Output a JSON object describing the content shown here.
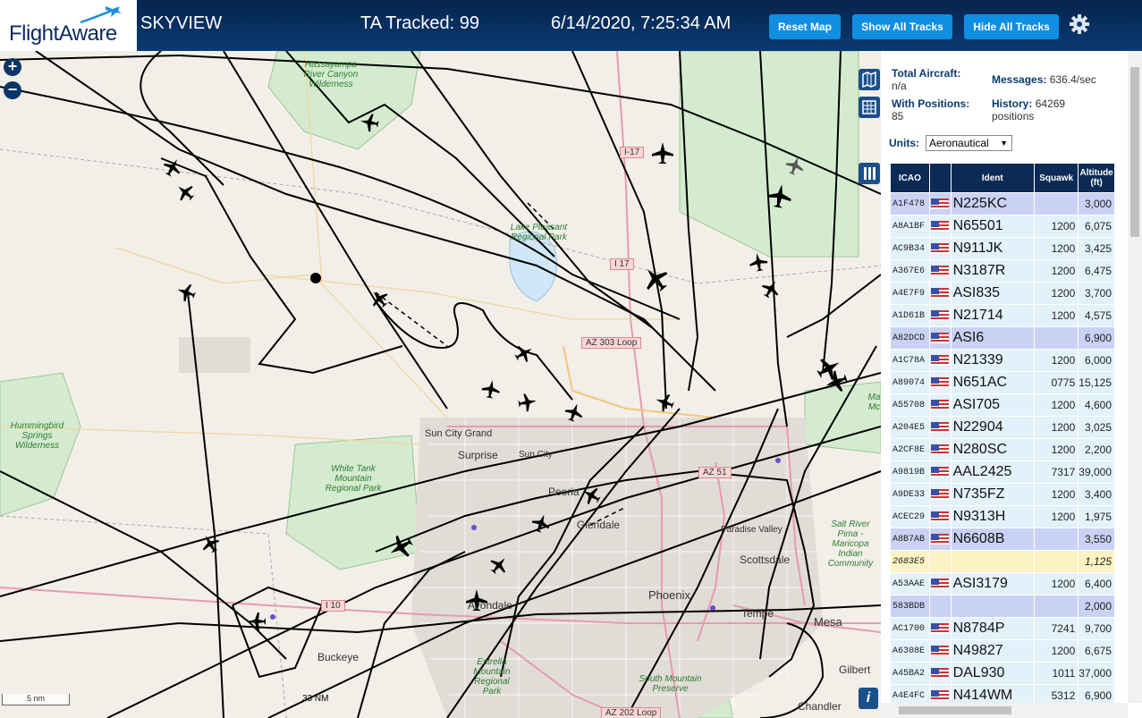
{
  "header": {
    "brand": "FlightAware",
    "site_name": "SKYVIEW",
    "tracked": "TA Tracked: 99",
    "datetime": "6/14/2020, 7:25:34 AM",
    "buttons": {
      "reset": "Reset Map",
      "show_all": "Show All Tracks",
      "hide_all": "Hide All Tracks"
    },
    "icons": {
      "settings": "gear-icon",
      "logo": "plane-icon"
    }
  },
  "map": {
    "zoom_in": "+",
    "zoom_out": "−",
    "controls": [
      "map-layers-icon",
      "grid-icon",
      "columns-icon"
    ],
    "info": "i",
    "scale_label": "5 nm",
    "range_label": "33 NM",
    "places": [
      "Sun City Grand",
      "Surprise",
      "Sun City",
      "Peoria",
      "Glendale",
      "Paradise Valley",
      "Scottsdale",
      "Phoenix",
      "Tempe",
      "Mesa",
      "Avondale",
      "Buckeye",
      "Gilbert",
      "Chandler"
    ],
    "parks": [
      "Hassayampa River Canyon Wilderness",
      "Lake Pleasant Regional Park",
      "Hummingbird Springs Wilderness",
      "White Tank Mountain Regional Park",
      "Estrella Mountain Regional Park",
      "South Mountain Preserve",
      "Salt River Pima - Maricopa Indian Community",
      "Ma Mc"
    ],
    "roads": [
      "I-17",
      "I 17",
      "AZ 303 Loop",
      "AZ 51",
      "I 10",
      "AZ 202 Loop"
    ]
  },
  "panel": {
    "total_aircraft_label": "Total Aircraft:",
    "total_aircraft_value": "n/a",
    "messages_label": "Messages:",
    "messages_value": "636.4/sec",
    "with_positions_label": "With Positions:",
    "with_positions_value": "85",
    "history_label": "History:",
    "history_value": "64269 positions",
    "units_label": "Units:",
    "units_value": "Aeronautical",
    "columns": [
      "ICAO",
      "",
      "Ident",
      "Squawk",
      "Altitude (ft)"
    ],
    "rows": [
      {
        "icao": "A1F478",
        "ident": "N225KC",
        "squawk": "",
        "alt": "3,000",
        "style": "r1"
      },
      {
        "icao": "A8A1BF",
        "ident": "N65501",
        "squawk": "1200",
        "alt": "6,075",
        "style": "r0"
      },
      {
        "icao": "AC9B34",
        "ident": "N911JK",
        "squawk": "1200",
        "alt": "3,425",
        "style": "r0"
      },
      {
        "icao": "A367E6",
        "ident": "N3187R",
        "squawk": "1200",
        "alt": "6,475",
        "style": "r0"
      },
      {
        "icao": "A4E7F9",
        "ident": "ASI835",
        "squawk": "1200",
        "alt": "3,700",
        "style": "r0"
      },
      {
        "icao": "A1D61B",
        "ident": "N21714",
        "squawk": "1200",
        "alt": "4,575",
        "style": "r0"
      },
      {
        "icao": "A82DCD",
        "ident": "ASI6",
        "squawk": "",
        "alt": "6,900",
        "style": "r1"
      },
      {
        "icao": "A1C78A",
        "ident": "N21339",
        "squawk": "1200",
        "alt": "6,000",
        "style": "r0"
      },
      {
        "icao": "A89074",
        "ident": "N651AC",
        "squawk": "0775",
        "alt": "15,125",
        "style": "r0"
      },
      {
        "icao": "A55708",
        "ident": "ASI705",
        "squawk": "1200",
        "alt": "4,600",
        "style": "r0"
      },
      {
        "icao": "A204E5",
        "ident": "N22904",
        "squawk": "1200",
        "alt": "3,025",
        "style": "r0"
      },
      {
        "icao": "A2CF8E",
        "ident": "N280SC",
        "squawk": "1200",
        "alt": "2,200",
        "style": "r0"
      },
      {
        "icao": "A9819B",
        "ident": "AAL2425",
        "squawk": "7317",
        "alt": "39,000",
        "style": "r0"
      },
      {
        "icao": "A9DE33",
        "ident": "N735FZ",
        "squawk": "1200",
        "alt": "3,400",
        "style": "r0"
      },
      {
        "icao": "ACEC29",
        "ident": "N9313H",
        "squawk": "1200",
        "alt": "1,975",
        "style": "r0"
      },
      {
        "icao": "A8B7AB",
        "ident": "N6608B",
        "squawk": "",
        "alt": "3,550",
        "style": "r1"
      },
      {
        "icao": "2683E5",
        "ident": "",
        "squawk": "",
        "alt": "1,125",
        "style": "r2",
        "noflag": true
      },
      {
        "icao": "A53AAE",
        "ident": "ASI3179",
        "squawk": "1200",
        "alt": "6,400",
        "style": "r0"
      },
      {
        "icao": "583BDB",
        "ident": "",
        "squawk": "",
        "alt": "2,000",
        "style": "r1",
        "noflag": true
      },
      {
        "icao": "AC1700",
        "ident": "N8784P",
        "squawk": "7241",
        "alt": "9,700",
        "style": "r0"
      },
      {
        "icao": "A6308E",
        "ident": "N49827",
        "squawk": "1200",
        "alt": "6,675",
        "style": "r0"
      },
      {
        "icao": "A45BA2",
        "ident": "DAL930",
        "squawk": "1011",
        "alt": "37,000",
        "style": "r0"
      },
      {
        "icao": "A4E4FC",
        "ident": "N414WM",
        "squawk": "5312",
        "alt": "6,900",
        "style": "r0"
      }
    ]
  },
  "colors": {
    "header_bg": "#0a3a72",
    "button_bg": "#0f8ee2",
    "table_header": "#0b2a56",
    "row_normal": "#e3f1fb",
    "row_selected": "#c9d2f3",
    "row_noflag": "#fbf3c3"
  }
}
